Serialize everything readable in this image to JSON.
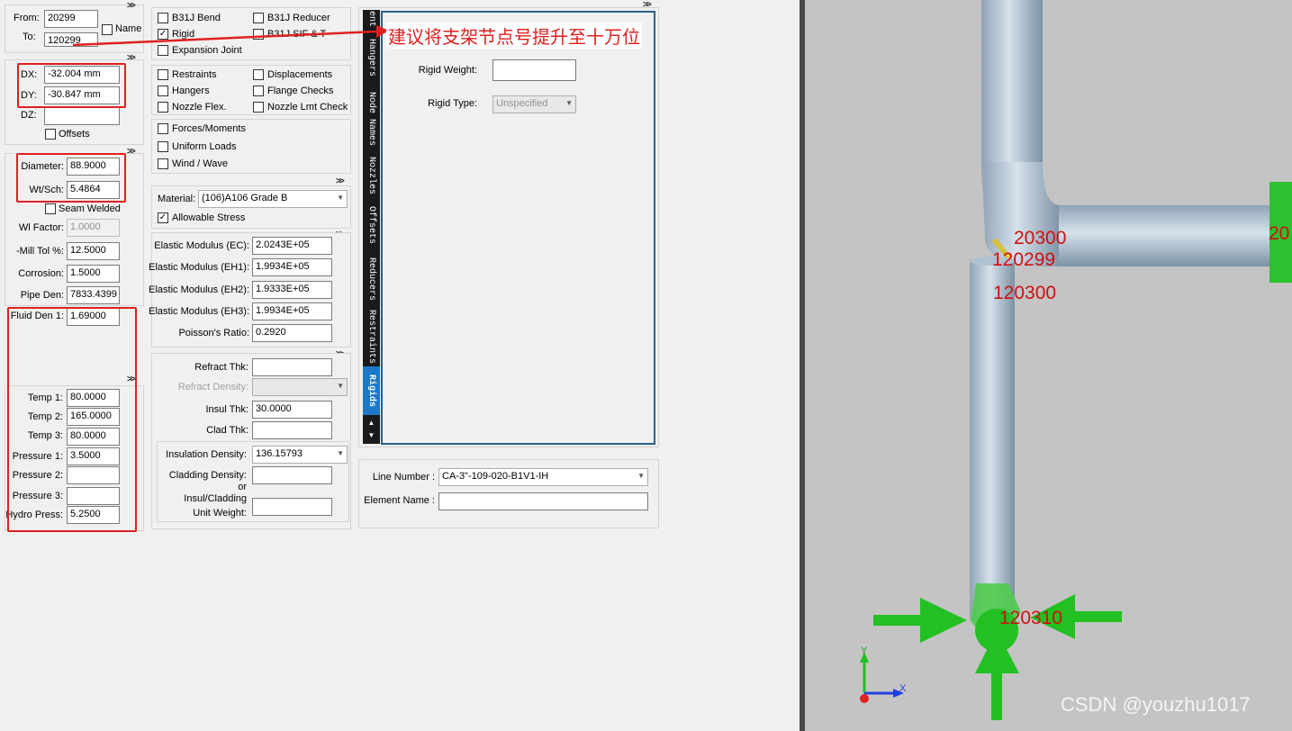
{
  "node_range": {
    "from_label": "From:",
    "from_value": "20299",
    "to_label": "To:",
    "to_value": "120299",
    "name_label": "Name"
  },
  "offsets": {
    "dx_label": "DX:",
    "dx_value": "-32.004 mm",
    "dy_label": "DY:",
    "dy_value": "-30.847 mm",
    "dz_label": "DZ:",
    "dz_value": "",
    "offsets_label": "Offsets"
  },
  "pipe": {
    "diameter_label": "Diameter:",
    "diameter_value": "88.9000",
    "wtsch_label": "Wt/Sch:",
    "wtsch_value": "5.4864",
    "seam_label": "Seam Welded",
    "wl_label": "Wl Factor:",
    "wl_value": "1.0000",
    "mill_label": "-Mill Tol %:",
    "mill_value": "12.5000",
    "corr_label": "Corrosion:",
    "corr_value": "1.5000",
    "den_label": "Pipe Den:",
    "den_value": "7833.4399",
    "fluid_label": "Fluid Den 1:",
    "fluid_value": "1.69000"
  },
  "temps": {
    "t1_label": "Temp 1:",
    "t1_value": "80.0000",
    "t2_label": "Temp 2:",
    "t2_value": "165.0000",
    "t3_label": "Temp 3:",
    "t3_value": "80.0000",
    "p1_label": "Pressure 1:",
    "p1_value": "3.5000",
    "p2_label": "Pressure 2:",
    "p2_value": "",
    "p3_label": "Pressure 3:",
    "p3_value": "",
    "hydro_label": "Hydro Press:",
    "hydro_value": "5.2500"
  },
  "checks": {
    "b31j_bend": "B31J Bend",
    "b31j_reducer": "B31J Reducer",
    "rigid": "Rigid",
    "b31j_sif": "B31J SIF & T",
    "expansion": "Expansion Joint",
    "restraints": "Restraints",
    "displacements": "Displacements",
    "hangers": "Hangers",
    "flange": "Flange Checks",
    "nozzle_flex": "Nozzle Flex.",
    "nozzle_lmt": "Nozzle Lmt Check",
    "forces": "Forces/Moments",
    "uniform": "Uniform Loads",
    "wind": "Wind / Wave",
    "check_mark": "✓"
  },
  "material": {
    "label": "Material:",
    "value": "(106)A106 Grade B",
    "allowable": "Allowable Stress"
  },
  "elastic": {
    "ec_label": "Elastic Modulus (EC):",
    "ec_value": "2.0243E+05",
    "eh1_label": "Elastic Modulus (EH1):",
    "eh1_value": "1.9934E+05",
    "eh2_label": "Elastic Modulus (EH2):",
    "eh2_value": "1.9333E+05",
    "eh3_label": "Elastic Modulus (EH3):",
    "eh3_value": "1.9934E+05",
    "poisson_label": "Poisson's Ratio:",
    "poisson_value": "0.2920"
  },
  "insulation": {
    "refract_thk_label": "Refract Thk:",
    "refract_thk_value": "",
    "refract_den_label": "Refract Density:",
    "insul_thk_label": "Insul Thk:",
    "insul_thk_value": "30.0000",
    "clad_thk_label": "Clad Thk:",
    "clad_thk_value": "",
    "insul_den_label": "Insulation Density:",
    "insul_den_value": "136.15793",
    "clad_den_label": "Cladding Density:",
    "clad_den_value": "",
    "or_label": "or",
    "unit_wt_label1": "Insul/Cladding",
    "unit_wt_label2": "Unit Weight:",
    "unit_wt_value": ""
  },
  "tabs": [
    "ent",
    "Hangers",
    "Node Names",
    "Nozzles",
    "Offsets",
    "Reducers",
    "Restraints",
    "Rigids"
  ],
  "rigid": {
    "weight_label": "Rigid Weight:",
    "weight_value": "",
    "type_label": "Rigid Type:",
    "type_value": "Unspecified"
  },
  "line": {
    "line_label": "Line Number :",
    "line_value": "CA-3\"-109-020-B1V1-IH",
    "elem_label": "Element Name :",
    "elem_value": ""
  },
  "annotation": "建议将支架节点号提升至十万位",
  "chev": ">>",
  "view": {
    "nodes": [
      "20300",
      "120299",
      "120300",
      "120310",
      "20"
    ],
    "axis_y": "Y",
    "axis_x": "X",
    "watermark": "CSDN @youzhu1017"
  },
  "colors": {
    "highlight_red": "#e02020",
    "pipe": "#b8cad8",
    "viewport_bg": "#c4c4c4",
    "restraint_green": "#22c022",
    "active_tab": "#1e78c8"
  }
}
